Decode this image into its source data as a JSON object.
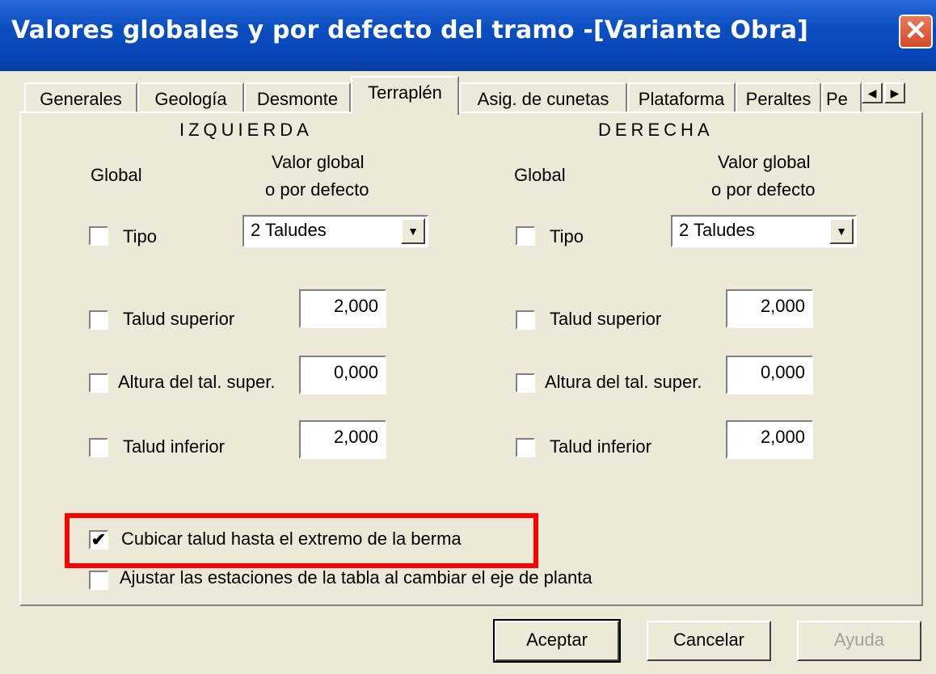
{
  "window": {
    "title": "Valores globales y por defecto del tramo -[Variante Obra]"
  },
  "tabs": [
    "Generales",
    "Geología",
    "Desmonte",
    "Terraplén",
    "Asig. de cunetas",
    "Plataforma",
    "Peraltes",
    "Pe"
  ],
  "active_tab": "Terraplén",
  "left": {
    "heading": "IZQUIERDA",
    "global_label": "Global",
    "value_label_1": "Valor global",
    "value_label_2": "o por defecto",
    "tipo_label": "Tipo",
    "tipo_value": "2 Taludes",
    "talud_superior_label": "Talud superior",
    "talud_superior_value": "2,000",
    "altura_label": "Altura del tal. super.",
    "altura_value": "0,000",
    "talud_inferior_label": "Talud inferior",
    "talud_inferior_value": "2,000"
  },
  "right": {
    "heading": "DERECHA",
    "global_label": "Global",
    "value_label_1": "Valor global",
    "value_label_2": "o por defecto",
    "tipo_label": "Tipo",
    "tipo_value": "2 Taludes",
    "talud_superior_label": "Talud superior",
    "talud_superior_value": "2,000",
    "altura_label": "Altura del tal. super.",
    "altura_value": "0,000",
    "talud_inferior_label": "Talud inferior",
    "talud_inferior_value": "2,000"
  },
  "options": {
    "cubicar_label": "Cubicar talud hasta el extremo de la berma",
    "cubicar_checked": true,
    "ajustar_label": "Ajustar las estaciones de la tabla al cambiar el eje de planta",
    "ajustar_checked": false
  },
  "buttons": {
    "accept": "Aceptar",
    "cancel": "Cancelar",
    "help": "Ayuda"
  },
  "colors": {
    "titlebar": "#0a4ec2",
    "highlight": "#ff0000",
    "face": "#ece9d8"
  }
}
